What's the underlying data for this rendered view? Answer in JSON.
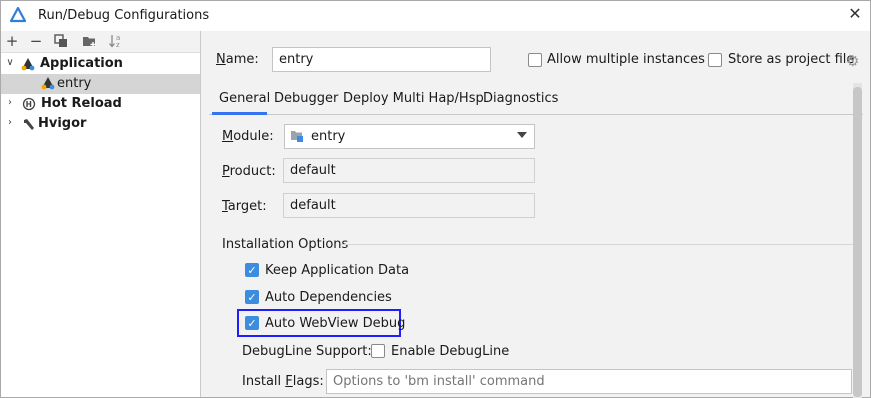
{
  "window": {
    "title": "Run/Debug Configurations"
  },
  "left_toolbar": {
    "add": "+",
    "remove": "−",
    "copy": "⧉",
    "folder": "▸",
    "sort": "↓a z"
  },
  "tree": [
    {
      "label": "Application",
      "expanded": true,
      "bold": true,
      "icon": "application-icon"
    },
    {
      "label": "entry",
      "selected": true,
      "icon": "application-icon"
    },
    {
      "label": "Hot Reload",
      "expanded": false,
      "bold": true,
      "icon": "hot-reload-icon"
    },
    {
      "label": "Hvigor",
      "expanded": false,
      "bold": true,
      "icon": "hvigor-icon"
    }
  ],
  "header": {
    "name_label": "Name:",
    "name_value": "entry",
    "allow_multiple": {
      "label": "Allow multiple instances",
      "checked": false
    },
    "store_as_file": {
      "label": "Store as project file",
      "checked": false
    }
  },
  "tabs": [
    "General",
    "Debugger",
    "Deploy Multi Hap/Hsp",
    "Diagnostics"
  ],
  "active_tab": "General",
  "general": {
    "module_label": "Module:",
    "module_value": "entry",
    "product_label": "Product:",
    "product_value": "default",
    "target_label": "Target:",
    "target_value": "default",
    "installation_options_title": "Installation Options",
    "options": [
      {
        "label": "Keep Application Data",
        "checked": true
      },
      {
        "label": "Auto Dependencies",
        "checked": true
      },
      {
        "label": "Auto WebView Debug",
        "checked": true
      }
    ],
    "debugline_label": "DebugLine Support:",
    "enable_debugline": {
      "label": "Enable DebugLine",
      "checked": false
    },
    "install_flags_label": "Install Flags:",
    "install_flags_placeholder": "Options to 'bm install' command"
  },
  "colors": {
    "accent": "#3c8ce0",
    "highlight_box": "#1e1eff",
    "selection": "#d5d5d5"
  }
}
